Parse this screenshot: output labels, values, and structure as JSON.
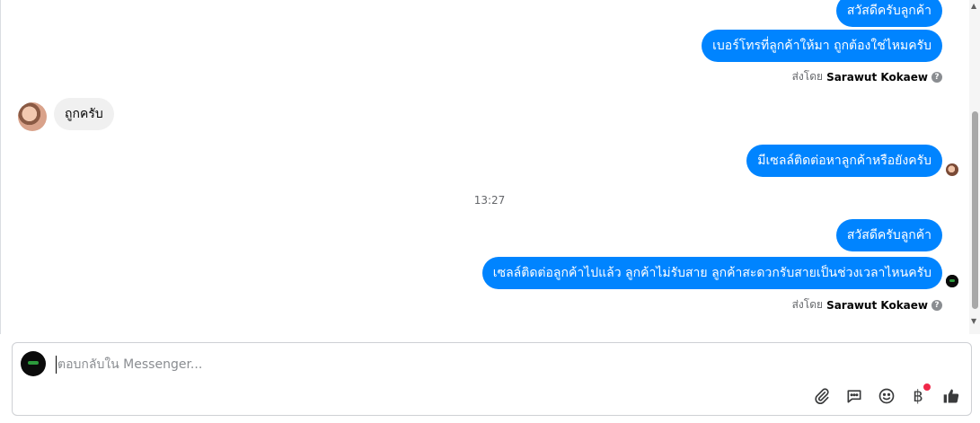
{
  "messages": [
    {
      "text": "สวัสดีครับลูกค้า"
    },
    {
      "text": "เบอร์โทรที่ลูกค้าให้มา ถูกต้องใช่ไหมครับ"
    },
    {
      "text": "ถูกครับ"
    },
    {
      "text": "มีเซลล์ติดต่อหาลูกค้าหรือยังครับ"
    },
    {
      "text": "สวัสดีครับลูกค้า"
    },
    {
      "text": "เซลล์ติดต่อลูกค้าไปแล้ว ลูกค้าไม่รับสาย ลูกค้าสะดวกรับสายเป็นช่วงเวลาไหนครับ"
    }
  ],
  "sent_by": {
    "prefix": "ส่งโดย",
    "name": "Sarawut Kokaew"
  },
  "timestamp": "13:27",
  "composer": {
    "placeholder": "ตอบกลับใน Messenger..."
  },
  "toolbar": {
    "baht_symbol": "฿"
  },
  "colors": {
    "outgoing_bubble": "#0084ff",
    "incoming_bubble": "#f0f0f0",
    "notification_dot": "#f02849"
  }
}
